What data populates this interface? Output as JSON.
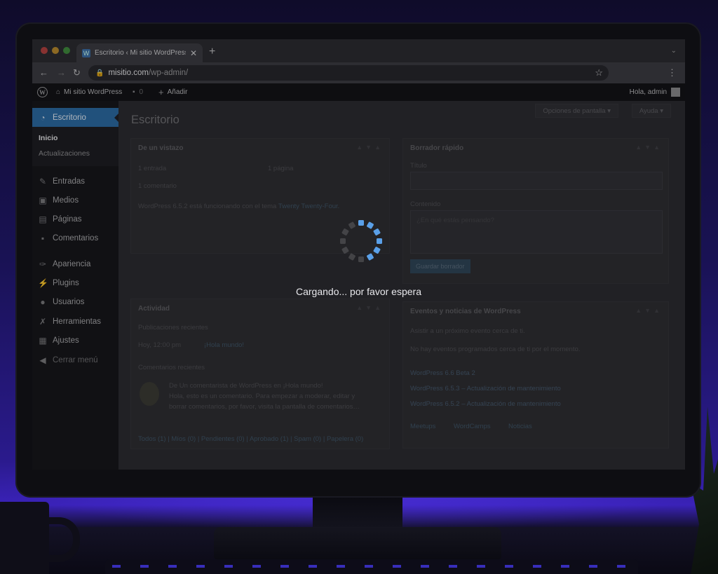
{
  "browser": {
    "tab_title": "Escritorio ‹ Mi sitio WordPress",
    "url_host": "misitio.com",
    "url_path": "/wp-admin/"
  },
  "adminbar": {
    "site_name": "Mi sitio WordPress",
    "comments_count": "0",
    "new_label": "Añadir",
    "greeting": "Hola, admin"
  },
  "sidebar": {
    "active": "Escritorio",
    "submenu": [
      "Inicio",
      "Actualizaciones"
    ],
    "items": [
      {
        "label": "Entradas",
        "icon": "pin-icon"
      },
      {
        "label": "Medios",
        "icon": "media-icon"
      },
      {
        "label": "Páginas",
        "icon": "pages-icon"
      },
      {
        "label": "Comentarios",
        "icon": "comment-icon"
      },
      {
        "label": "Apariencia",
        "icon": "brush-icon"
      },
      {
        "label": "Plugins",
        "icon": "plugin-icon"
      },
      {
        "label": "Usuarios",
        "icon": "user-icon"
      },
      {
        "label": "Herramientas",
        "icon": "wrench-icon"
      },
      {
        "label": "Ajustes",
        "icon": "settings-icon"
      },
      {
        "label": "Cerrar menú",
        "icon": "collapse-icon"
      }
    ]
  },
  "main": {
    "title": "Escritorio",
    "screen_options": "Opciones de pantalla",
    "help": "Ayuda",
    "glance": {
      "title": "De un vistazo",
      "posts": "1 entrada",
      "pages": "1 página",
      "comments": "1 comentario",
      "version_text": "WordPress 6.5.2 está funcionando con el tema",
      "theme_link": "Twenty Twenty-Four."
    },
    "quick_draft": {
      "title": "Borrador rápido",
      "title_label": "Título",
      "content_label": "Contenido",
      "content_placeholder": "¿En qué estás pensando?",
      "save_button": "Guardar borrador"
    },
    "activity": {
      "title": "Actividad",
      "recent_posts": "Publicaciones recientes",
      "post_date": "Hoy, 12:00 pm",
      "post_title": "¡Hola mundo!",
      "recent_comments": "Comentarios recientes",
      "comment_line1": "De Un comentarista de WordPress en ¡Hola mundo!",
      "comment_line2": "Hola, esto es un comentario. Para empezar a moderar, editar y",
      "comment_line3": "borrar comentarios, por favor, visita la pantalla de comentarios…",
      "filters": "Todos (1) | Míos (0) | Pendientes (0) | Aprobado (1) | Spam (0) | Papelera (0)"
    },
    "events": {
      "title": "Eventos y noticias de WordPress",
      "attend": "Asistir a un próximo evento cerca de ti.",
      "no_events": "No hay eventos programados cerca de ti por el momento.",
      "news1": "WordPress 6.6 Beta 2",
      "news2": "WordPress 6.5.3 – Actualización de mantenimiento",
      "news3": "WordPress 6.5.2 – Actualización de mantenimiento",
      "meetups": "Meetups",
      "wordcamps": "WordCamps",
      "noticias": "Noticias"
    }
  },
  "overlay": {
    "loading_text": "Cargando... por favor espera",
    "accent": "#5aa0e8"
  }
}
